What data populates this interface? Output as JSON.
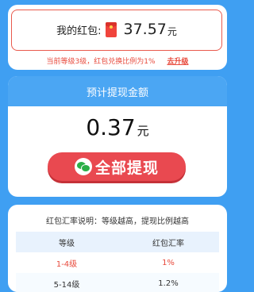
{
  "redpacket": {
    "label": "我的红包:",
    "amount": "37.57",
    "unit": "元",
    "level_text": "当前等级3级，红包兑换比例为1%",
    "upgrade_link": "去升级"
  },
  "withdraw": {
    "header": "预计提现金额",
    "amount": "0.37",
    "unit": "元",
    "button_label": "全部提现"
  },
  "rates": {
    "note": "红包汇率说明：等级越高，提现比例越高",
    "columns": [
      "等级",
      "红包汇率"
    ],
    "rows": [
      [
        "1-4级",
        "1%"
      ],
      [
        "5-14级",
        "1.2%"
      ]
    ]
  },
  "colors": {
    "background": "#3f9ff2",
    "accent_red": "#e94950",
    "header_blue": "#4ba6f3"
  }
}
